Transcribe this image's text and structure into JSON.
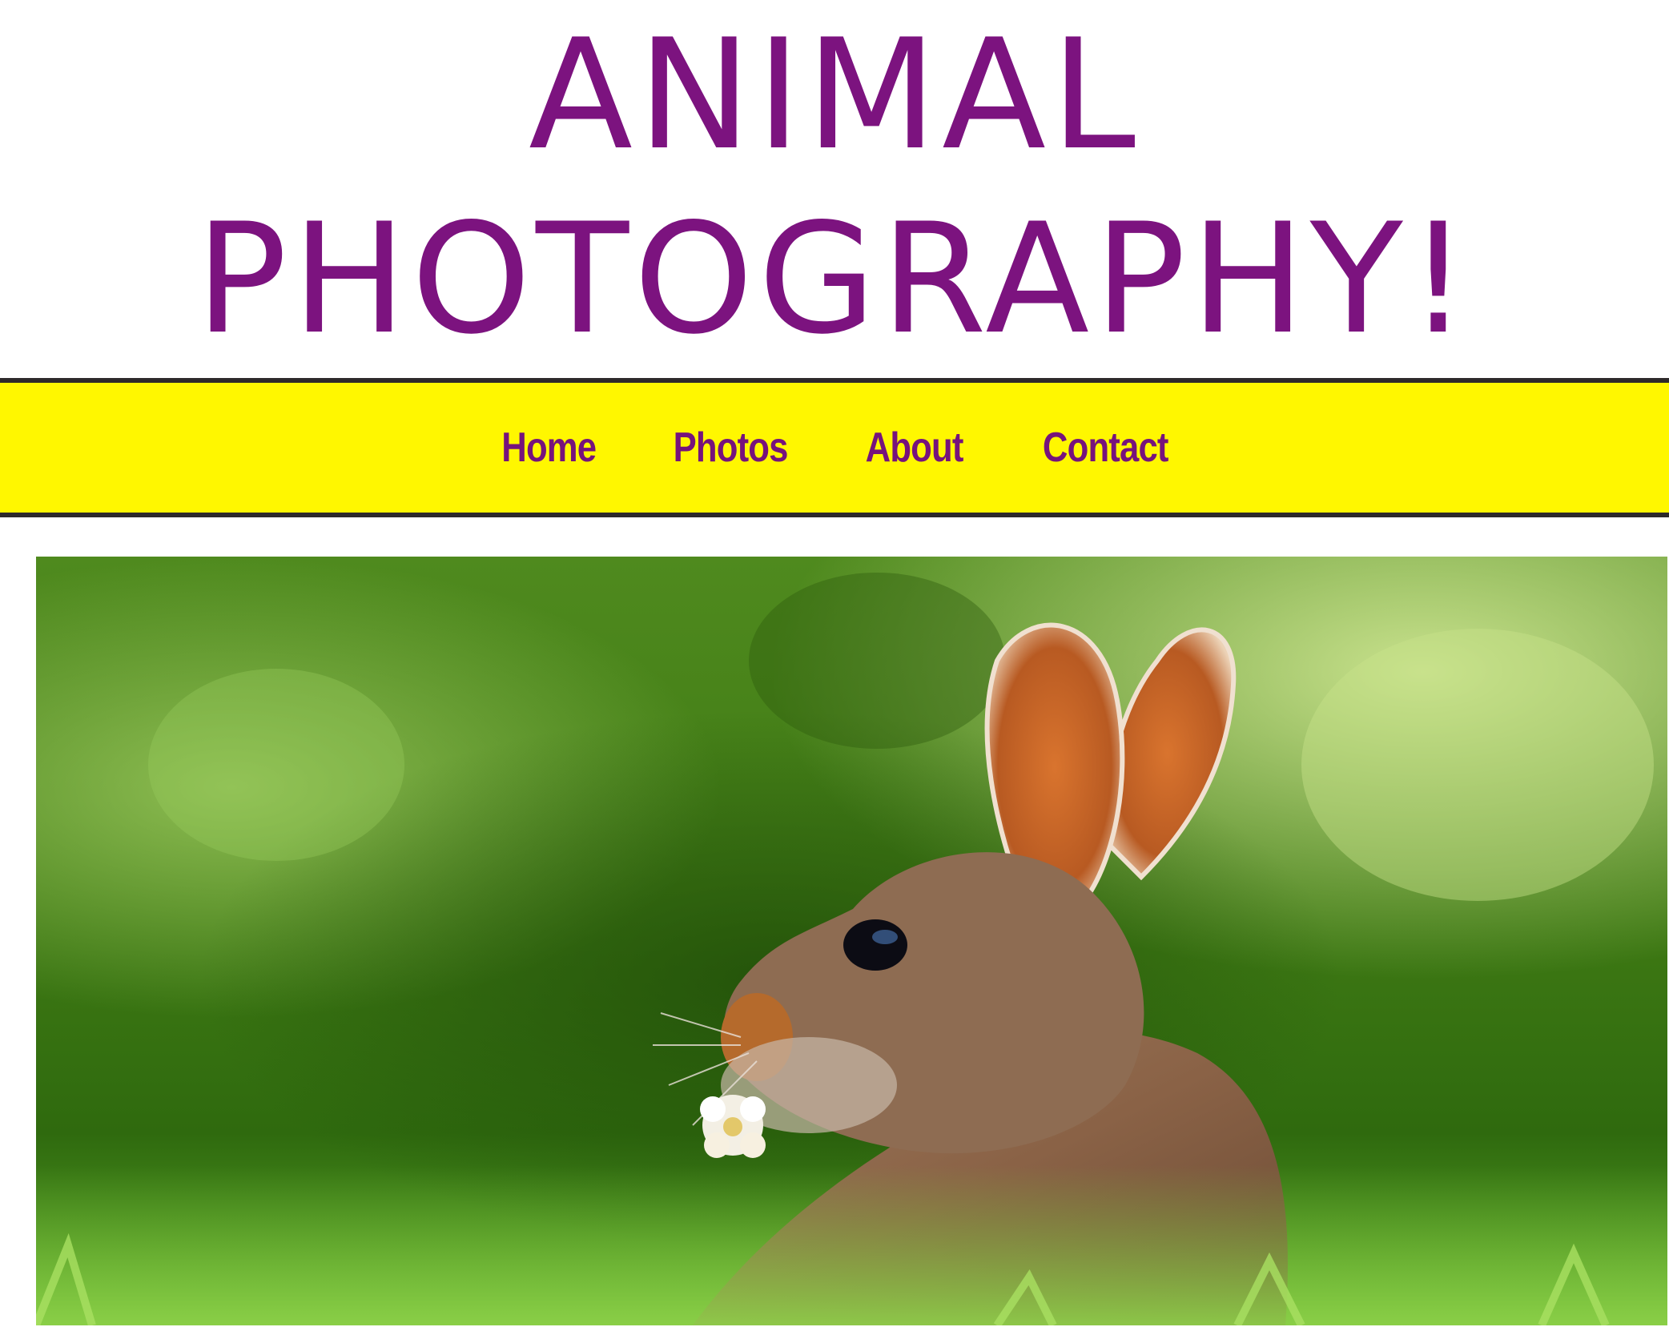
{
  "header": {
    "title_line1": "ANIMAL",
    "title_line2": "PHOTOGRAPHY!"
  },
  "nav": {
    "items": [
      {
        "label": "Home"
      },
      {
        "label": "Photos"
      },
      {
        "label": "About"
      },
      {
        "label": "Contact"
      }
    ]
  },
  "hero": {
    "image_subject": "rabbit-photo"
  },
  "colors": {
    "title": "#7c137f",
    "nav_background": "#fff700",
    "nav_text": "#76137c",
    "nav_border": "#2e2a2b",
    "page_background": "#ffffff"
  }
}
